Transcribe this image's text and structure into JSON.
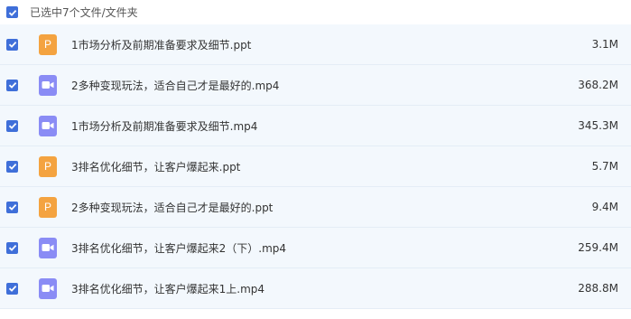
{
  "header": {
    "label": "已选中7个文件/文件夹",
    "checked": true
  },
  "colors": {
    "checkbox": "#3f6fd9",
    "ppt_icon": "#f4a340",
    "mp4_icon": "#8a8cf5",
    "row_bg": "#f3f8fd"
  },
  "files": [
    {
      "name": "1市场分析及前期准备要求及细节.ppt",
      "size": "3.1M",
      "type": "ppt",
      "icon": "ppt-icon",
      "checked": true
    },
    {
      "name": "2多种变现玩法，适合自己才是最好的.mp4",
      "size": "368.2M",
      "type": "mp4",
      "icon": "video-icon",
      "checked": true
    },
    {
      "name": "1市场分析及前期准备要求及细节.mp4",
      "size": "345.3M",
      "type": "mp4",
      "icon": "video-icon",
      "checked": true
    },
    {
      "name": "3排名优化细节，让客户爆起来.ppt",
      "size": "5.7M",
      "type": "ppt",
      "icon": "ppt-icon",
      "checked": true
    },
    {
      "name": "2多种变现玩法，适合自己才是最好的.ppt",
      "size": "9.4M",
      "type": "ppt",
      "icon": "ppt-icon",
      "checked": true
    },
    {
      "name": "3排名优化细节，让客户爆起来2（下）.mp4",
      "size": "259.4M",
      "type": "mp4",
      "icon": "video-icon",
      "checked": true
    },
    {
      "name": "3排名优化细节，让客户爆起来1上.mp4",
      "size": "288.8M",
      "type": "mp4",
      "icon": "video-icon",
      "checked": true
    }
  ]
}
